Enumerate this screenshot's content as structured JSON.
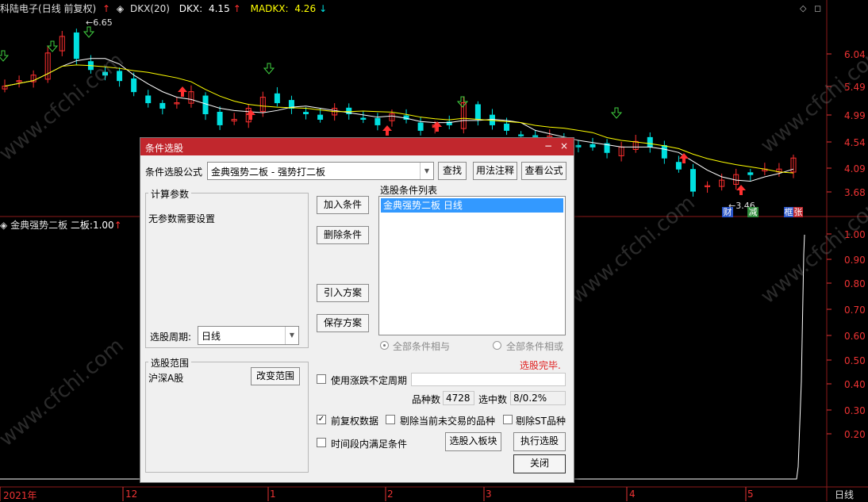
{
  "chart": {
    "title_bar": {
      "stock_name": "科陆电子",
      "period_mode": "(日线 前复权)",
      "indicator": "DKX(20)",
      "dkx_label": "DKX:",
      "dkx_value": "4.15",
      "madkx_label": "MADKX:",
      "madkx_value": "4.26",
      "up_arrow": "↑",
      "down_arrow": "↓"
    },
    "sub_title": {
      "indicator": "金典强势二板",
      "line_label": "二板:",
      "value": "1.00",
      "arrow": "↑"
    },
    "price_axis": [
      "6.04",
      "5.49",
      "4.99",
      "4.54",
      "4.09",
      "3.68"
    ],
    "sub_axis": [
      "1.00",
      "0.90",
      "0.80",
      "0.70",
      "0.60",
      "0.50",
      "0.40",
      "0.30",
      "0.20"
    ],
    "date_axis": [
      "2021年",
      "12",
      "1",
      "2",
      "3",
      "4",
      "5"
    ],
    "period_tag": "日线",
    "high_price_label": "6.65",
    "low_price_label": "3.46",
    "event_tags": [
      "财",
      "减",
      "框",
      "张"
    ],
    "colors": {
      "up": "#ff3030",
      "down": "#00e0e0",
      "dkx": "#ffffff",
      "madkx": "#ffff00",
      "axis": "#e33333"
    },
    "chart_data": {
      "type": "candlestick",
      "ylim": [
        3.4,
        6.8
      ],
      "close_series_approx": [
        5.6,
        5.7,
        5.8,
        6.2,
        6.5,
        6.1,
        5.9,
        5.8,
        5.7,
        5.5,
        5.3,
        5.2,
        5.3,
        5.5,
        5.1,
        4.9,
        5.0,
        5.2,
        5.4,
        5.3,
        5.2,
        5.1,
        5.0,
        5.2,
        5.1,
        5.0,
        4.9,
        5.1,
        5.0,
        4.8,
        4.9,
        4.9,
        5.3,
        5.0,
        4.9,
        4.8,
        4.7,
        4.6,
        4.7,
        4.6,
        4.5,
        4.5,
        4.4,
        4.5,
        4.6,
        4.5,
        4.3,
        4.1,
        3.7,
        3.8,
        3.9,
        4.0,
        4.0,
        4.1,
        4.1,
        4.3
      ]
    },
    "watermark_text": "www.cfchi.com"
  },
  "dialog": {
    "title": "条件选股",
    "minimize": "−",
    "close": "×",
    "formula_label": "条件选股公式",
    "formula_value": "金典强势二板 - 强势打二板",
    "btn_find": "查找",
    "btn_usage": "用法注释",
    "btn_view_formula": "查看公式",
    "params_group": "计算参数",
    "params_text": "无参数需要设置",
    "cycle_label": "选股周期:",
    "cycle_value": "日线",
    "btn_add": "加入条件",
    "btn_delete": "删除条件",
    "btn_import": "引入方案",
    "btn_save": "保存方案",
    "list_title": "选股条件列表",
    "list_items": [
      "金典强势二板  日线"
    ],
    "radio_and": "全部条件相与",
    "radio_or": "全部条件相或",
    "status": "选股完毕.",
    "range_group": "选股范围",
    "range_value": "沪深Α股",
    "btn_change_range": "改变范围",
    "check_uncertain": "使用涨跌不定周期",
    "count_label": "品种数",
    "count_value": "4728",
    "selected_label": "选中数",
    "selected_value": "8/0.2%",
    "check_restore": "前复权数据",
    "check_exclude_untraded": "剔除当前未交易的品种",
    "check_exclude_st": "剔除ST品种",
    "check_period_condition": "时间段内满足条件",
    "btn_to_block": "选股入板块",
    "btn_execute": "执行选股",
    "btn_close": "关闭"
  }
}
